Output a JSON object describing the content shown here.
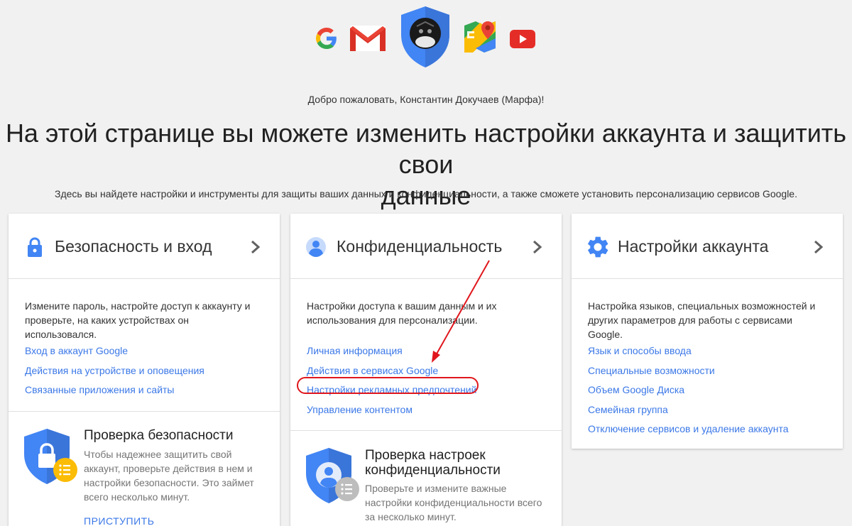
{
  "header": {
    "welcome": "Добро пожаловать, Константин Докучаев (Марфа)!",
    "headline_line1": "На этой странице вы можете изменить настройки аккаунта и защитить свои",
    "headline_line2": "данные",
    "subline": "Здесь вы найдете настройки и инструменты для защиты ваших данных и конфиденциальности, а также сможете установить персонализацию сервисов Google.",
    "logos": [
      "google-g-logo",
      "gmail-logo",
      "avatar-shield",
      "google-maps-logo",
      "youtube-logo"
    ]
  },
  "cards": [
    {
      "title": "Безопасность и вход",
      "icon": "lock-icon",
      "description": "Измените пароль, настройте доступ к аккаунту и проверьте, на каких устройствах он использовался.",
      "links": [
        "Вход в аккаунт Google",
        "Действия на устройстве и оповещения",
        "Связанные приложения и сайты"
      ],
      "check": {
        "title": "Проверка безопасности",
        "description": "Чтобы надежнее защитить свой аккаунт, проверьте действия в нем и настройки безопасности. Это займет всего несколько минут.",
        "action": "ПРИСТУПИТЬ"
      }
    },
    {
      "title": "Конфиденциальность",
      "icon": "person-icon",
      "description": "Настройки доступа к вашим данным и их использования для персонализации.",
      "links": [
        "Личная информация",
        "Действия в сервисах Google",
        "Настройки рекламных предпочтений",
        "Управление контентом"
      ],
      "check": {
        "title_line1": "Проверка настроек",
        "title_line2": "конфиденциальности",
        "description": "Проверьте и измените важные настройки конфиденциальности всего за несколько минут."
      }
    },
    {
      "title": "Настройки аккаунта",
      "icon": "gear-icon",
      "description": "Настройка языков, специальных возможностей и других параметров для работы с сервисами Google.",
      "links": [
        "Язык и способы ввода",
        "Специальные возможности",
        "Объем Google Диска",
        "Семейная группа",
        "Отключение сервисов и удаление аккаунта"
      ]
    }
  ],
  "colors": {
    "link": "#3b78e7",
    "accent_blue": "#4285f4",
    "annotation_red": "#e0161c",
    "badge_yellow": "#fbbc05",
    "badge_grey": "#9e9e9e"
  }
}
